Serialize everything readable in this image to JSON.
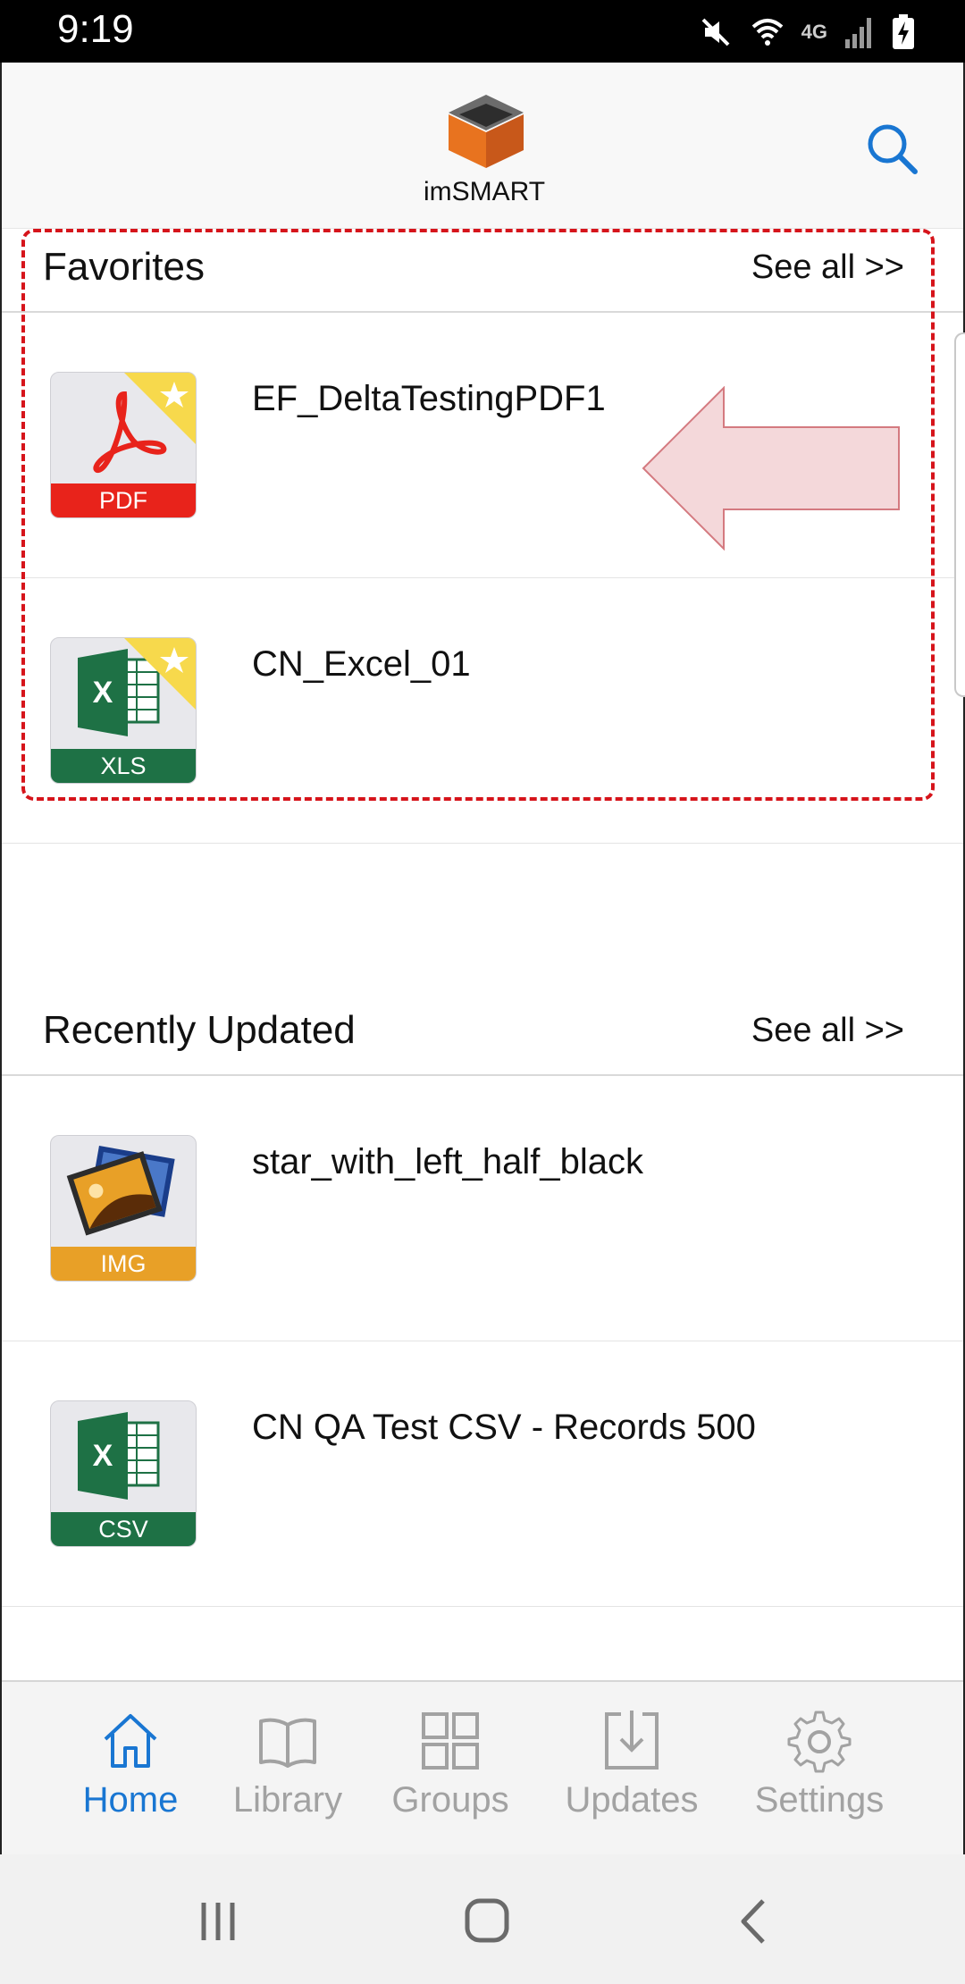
{
  "status_bar": {
    "time": "9:19",
    "network": "4G",
    "icons": [
      "mute-icon",
      "wifi-icon",
      "signal-icon",
      "battery-charging-icon"
    ]
  },
  "header": {
    "app_name": "imSMART",
    "logo": "imsmart-cube-logo",
    "search_icon": "search-icon"
  },
  "favorites": {
    "title": "Favorites",
    "see_all": "See all >>",
    "items": [
      {
        "name": "EF_DeltaTestingPDF1",
        "type_label": "PDF",
        "icon": "pdf-file-icon",
        "favorite": true,
        "band_color": "#e8231b"
      },
      {
        "name": "CN_Excel_01",
        "type_label": "XLS",
        "icon": "excel-file-icon",
        "favorite": true,
        "band_color": "#1e7145"
      }
    ]
  },
  "recently_updated": {
    "title": "Recently Updated",
    "see_all": "See all >>",
    "items": [
      {
        "name": "star_with_left_half_black",
        "type_label": "IMG",
        "icon": "image-file-icon",
        "favorite": false,
        "band_color": "#e8a027"
      },
      {
        "name": "CN QA Test CSV - Records 500",
        "type_label": "CSV",
        "icon": "csv-file-icon",
        "favorite": false,
        "band_color": "#1e7145"
      }
    ]
  },
  "tabs": [
    {
      "label": "Home",
      "icon": "home-icon",
      "active": true
    },
    {
      "label": "Library",
      "icon": "book-icon",
      "active": false
    },
    {
      "label": "Groups",
      "icon": "grid-icon",
      "active": false
    },
    {
      "label": "Updates",
      "icon": "download-icon",
      "active": false
    },
    {
      "label": "Settings",
      "icon": "gear-icon",
      "active": false
    }
  ],
  "nav_bar": {
    "buttons": [
      "recents-icon",
      "home-circle-icon",
      "back-icon"
    ]
  },
  "colors": {
    "accent": "#1976d2",
    "highlight": "#d6141b",
    "favorite_star": "#f7d94c",
    "logo_orange": "#e8731f"
  }
}
